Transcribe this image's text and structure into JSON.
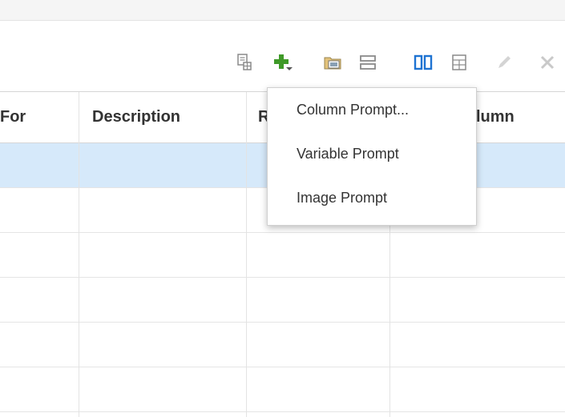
{
  "toolbar": {
    "icons": [
      "report-icon",
      "add-prompt-icon",
      "image-folder-icon",
      "horizontal-layout-icon",
      "vertical-layout-icon",
      "grid-layout-icon",
      "edit-icon",
      "delete-icon"
    ],
    "colors": {
      "add": "#3f9a28",
      "active": "#1e73d2",
      "gray": "#8a8a8a",
      "disabled": "#c9c9c9"
    }
  },
  "table": {
    "columns": [
      "For",
      "Description",
      "R",
      "lumn"
    ],
    "rows": [
      [
        "",
        "",
        "",
        ""
      ],
      [
        "",
        "",
        "",
        ""
      ],
      [
        "",
        "",
        "",
        ""
      ],
      [
        "",
        "",
        "",
        ""
      ],
      [
        "",
        "",
        "",
        ""
      ],
      [
        "",
        "",
        "",
        ""
      ]
    ],
    "selected_row": 0,
    "selected_color": "#d6e9fa"
  },
  "menu": {
    "items": [
      "Column Prompt...",
      "Variable Prompt",
      "Image Prompt"
    ]
  }
}
